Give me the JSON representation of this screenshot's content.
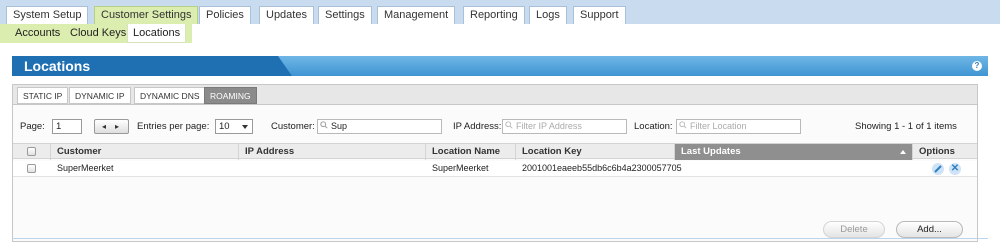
{
  "topnav": {
    "tabs": [
      {
        "label": "System Setup",
        "active": false
      },
      {
        "label": "Customer Settings",
        "active": true
      },
      {
        "label": "Policies",
        "active": false
      },
      {
        "label": "Updates",
        "active": false
      },
      {
        "label": "Settings",
        "active": false
      },
      {
        "label": "Management",
        "active": false
      },
      {
        "label": "Reporting",
        "active": false
      },
      {
        "label": "Logs",
        "active": false
      },
      {
        "label": "Support",
        "active": false
      }
    ]
  },
  "subnav": {
    "tabs": [
      {
        "label": "Accounts",
        "active": false
      },
      {
        "label": "Cloud Keys",
        "active": false
      },
      {
        "label": "Locations",
        "active": true
      }
    ]
  },
  "panel": {
    "title": "Locations",
    "help_icon": "question-icon",
    "location_tabs": [
      {
        "label": "STATIC IP",
        "active": false
      },
      {
        "label": "DYNAMIC IP",
        "active": false
      },
      {
        "label": "DYNAMIC DNS",
        "active": false
      },
      {
        "label": "ROAMING",
        "active": true
      }
    ]
  },
  "toolbar": {
    "page_label": "Page:",
    "page_value": "1",
    "pager_prev": "◂",
    "pager_next": "▸",
    "entries_label": "Entries per page:",
    "entries_value": "10",
    "customer_label": "Customer:",
    "customer_value": "Sup",
    "ip_label": "IP Address:",
    "ip_placeholder": "Filter IP Address",
    "location_label": "Location:",
    "location_placeholder": "Filter Location",
    "showing": "Showing 1 - 1 of 1 items"
  },
  "table": {
    "columns": [
      "Customer",
      "IP Address",
      "Location Name",
      "Location Key",
      "Last Updates",
      "Options"
    ],
    "sorted_column": "Last Updates",
    "rows": [
      {
        "customer": "SuperMeerket",
        "ip_address": "",
        "location_name": "SuperMeerket",
        "location_key": "2001001eaeeb55db6c6b4a2300057705",
        "last_updates": ""
      }
    ]
  },
  "actions": {
    "delete_label": "Delete",
    "add_label": "Add..."
  },
  "colors": {
    "accent_blue": "#1f6fb3",
    "active_tab_green": "#dcedb0",
    "sorted_header_gray": "#8f8f8f"
  }
}
